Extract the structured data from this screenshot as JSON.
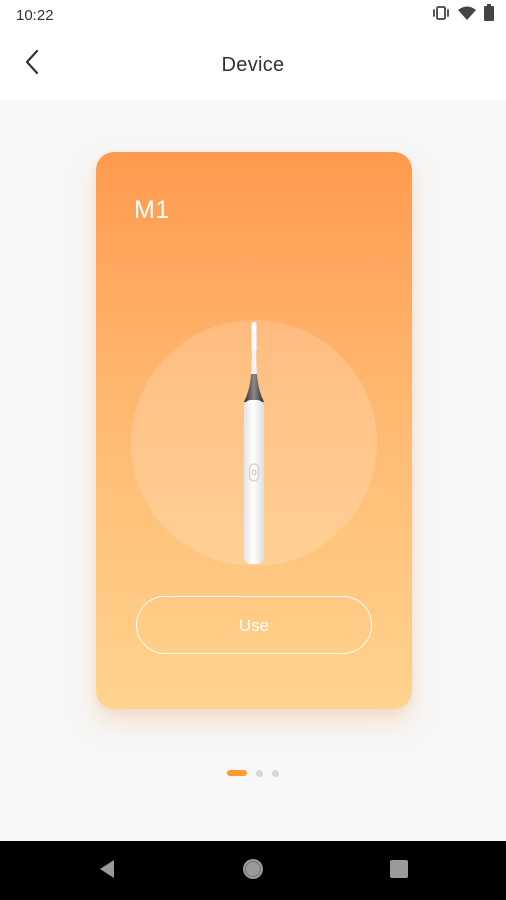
{
  "status_bar": {
    "time": "10:22",
    "icons": [
      "vibrate-icon",
      "wifi-icon",
      "battery-icon"
    ]
  },
  "app_bar": {
    "title": "Device",
    "back_icon": "chevron-left-icon"
  },
  "device_card": {
    "name": "M1",
    "image": "toothbrush-image",
    "use_button_label": "Use",
    "gradient_colors": [
      "#ff9a4e",
      "#ffd38e"
    ]
  },
  "pager": {
    "page_count": 3,
    "active_page": 1,
    "active_color": "#ff9a2e"
  },
  "system_nav": {
    "buttons": [
      "back-triangle-icon",
      "home-circle-icon",
      "recents-square-icon"
    ]
  }
}
